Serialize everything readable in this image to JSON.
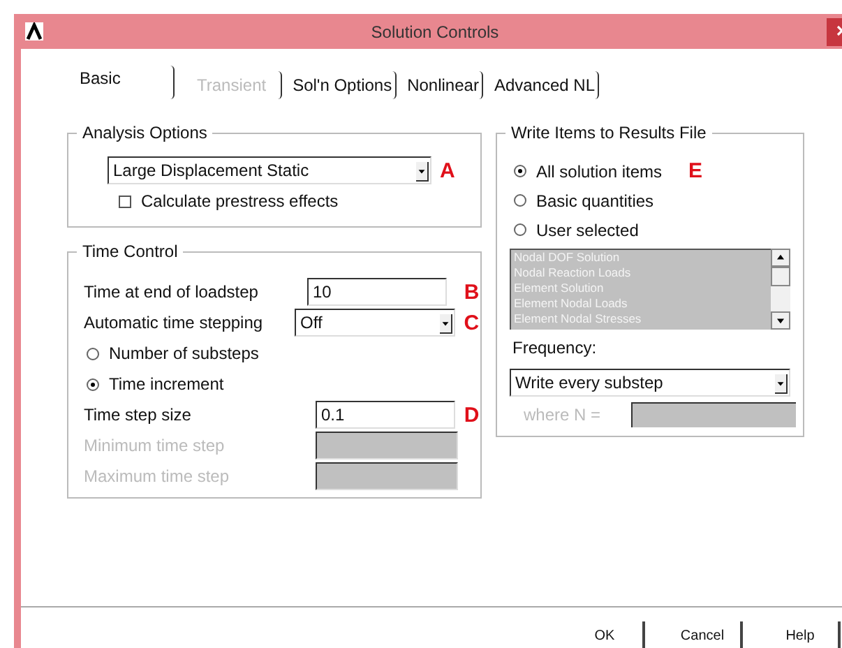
{
  "window": {
    "title": "Solution Controls"
  },
  "tabs": [
    {
      "label": "Basic",
      "selected": true,
      "disabled": false
    },
    {
      "label": "Transient",
      "selected": false,
      "disabled": true
    },
    {
      "label": "Sol'n Options",
      "selected": false,
      "disabled": false
    },
    {
      "label": "Nonlinear",
      "selected": false,
      "disabled": false
    },
    {
      "label": "Advanced NL",
      "selected": false,
      "disabled": false
    }
  ],
  "analysis_options": {
    "title": "Analysis Options",
    "analysis_type": {
      "value": "Large Displacement Static",
      "marker": "A"
    },
    "prestress": {
      "label": "Calculate prestress effects",
      "checked": false
    }
  },
  "time_control": {
    "title": "Time Control",
    "rows": [
      {
        "kind": "field",
        "label": "Time at end of loadstep",
        "value": "10",
        "marker": "B",
        "disabled": false
      },
      {
        "kind": "dropdown",
        "label": "Automatic time stepping",
        "value": "Off",
        "marker": "C",
        "disabled": false
      },
      {
        "kind": "radio",
        "label": "Number of substeps",
        "selected": false
      },
      {
        "kind": "radio",
        "label": "Time increment",
        "selected": true
      },
      {
        "kind": "field",
        "label": "Time step size",
        "value": "0.1",
        "marker": "D",
        "disabled": false
      },
      {
        "kind": "field",
        "label": "Minimum time step",
        "disabled": true
      },
      {
        "kind": "field",
        "label": "Maximum time step",
        "disabled": true
      }
    ]
  },
  "write_items": {
    "title": "Write Items to Results File",
    "options": [
      {
        "label": "All solution items",
        "selected": true,
        "marker": "E"
      },
      {
        "label": "Basic quantities",
        "selected": false
      },
      {
        "label": "User selected",
        "selected": false
      }
    ],
    "items": [
      "Nodal DOF Solution",
      "Nodal Reaction Loads",
      "Element Solution",
      "Element Nodal Loads",
      "Element Nodal Stresses"
    ],
    "items_disabled": true,
    "frequency_label": "Frequency:",
    "frequency": "Write every substep",
    "where_n": {
      "label": "where N =",
      "disabled": true
    }
  },
  "buttons": [
    "OK",
    "Cancel",
    "Help"
  ]
}
